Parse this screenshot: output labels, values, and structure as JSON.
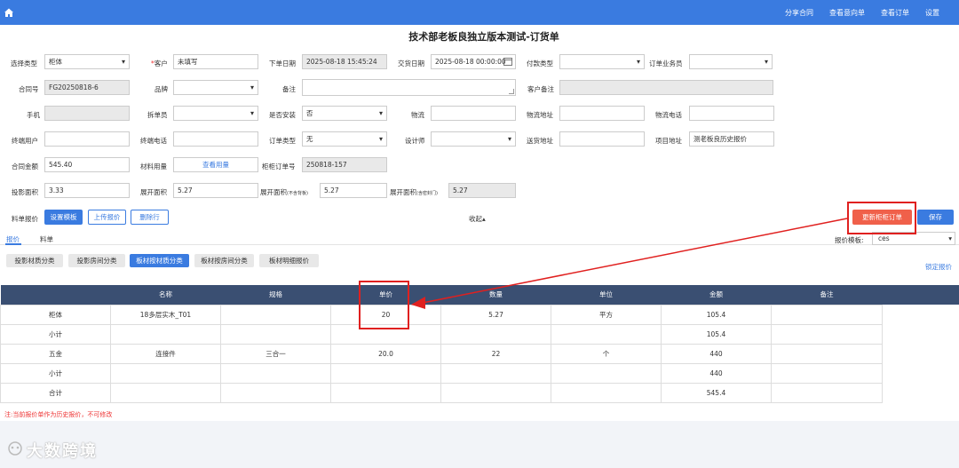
{
  "topbar": {
    "nav": [
      "分享合同",
      "查看意向单",
      "查看订单",
      "设置"
    ]
  },
  "title": "技术部老板良独立版本测试-订货单",
  "form": {
    "select_type": {
      "label": "选择类型",
      "value": "柜体"
    },
    "customer": {
      "label": "客户",
      "value": "未填写"
    },
    "order_date": {
      "label": "下单日期",
      "value": "2025-08-18 15:45:24"
    },
    "delivery_date": {
      "label": "交货日期",
      "value": "2025-08-18 00:00:00"
    },
    "payment_type": {
      "label": "付款类型",
      "value": ""
    },
    "salesperson": {
      "label": "订单业务员",
      "value": ""
    },
    "contract_no": {
      "label": "合同号",
      "value": "FG20250818-6"
    },
    "brand": {
      "label": "品牌",
      "value": ""
    },
    "remark": {
      "label": "备注",
      "value": ""
    },
    "customer_remark": {
      "label": "客户备注",
      "value": ""
    },
    "phone": {
      "label": "手机",
      "value": ""
    },
    "splitter": {
      "label": "拆单员",
      "value": ""
    },
    "install": {
      "label": "是否安装",
      "value": "否"
    },
    "logistics": {
      "label": "物流",
      "value": ""
    },
    "logistics_address": {
      "label": "物流地址",
      "value": ""
    },
    "logistics_phone": {
      "label": "物流电话",
      "value": ""
    },
    "end_user": {
      "label": "终端用户",
      "value": ""
    },
    "end_phone": {
      "label": "终端电话",
      "value": ""
    },
    "order_type": {
      "label": "订单类型",
      "value": "无"
    },
    "designer": {
      "label": "设计师",
      "value": ""
    },
    "ship_address": {
      "label": "送货地址",
      "value": ""
    },
    "project_address": {
      "label": "项目地址",
      "value": "测老板良历史报价"
    },
    "contract_amount": {
      "label": "合同金额",
      "value": "545.40"
    },
    "material_usage": {
      "label": "材料用量",
      "value": "查看用量"
    },
    "cabinet_order_no": {
      "label": "柜柜订单号",
      "value": "250818-157"
    },
    "projected_area": {
      "label": "投影面积",
      "value": "3.33"
    },
    "unfolded_area": {
      "label": "展开面积",
      "value": "5.27"
    },
    "unfolded_area_nodoor": {
      "label": "展开面积",
      "sub": "(不含背板)",
      "value": "5.27"
    },
    "unfolded_area_door": {
      "label": "展开面积",
      "sub": "(含密封门)",
      "value": "5.27"
    }
  },
  "quote_actions": {
    "label": "料单报价",
    "set_template": "设置模板",
    "upload": "上传报价",
    "delete_row": "删除行"
  },
  "collapse_label": "收起▴",
  "update_button": "更新柜柜订单",
  "save_button": "保存",
  "tabs": [
    "报价",
    "料单"
  ],
  "quote_template": {
    "label": "报价模板:",
    "value": "ces"
  },
  "categories": [
    "投影材质分类",
    "投影房间分类",
    "板材按材质分类",
    "板材按房间分类",
    "板材明细报价"
  ],
  "lock_quote": "锁定报价",
  "table": {
    "headers": [
      "",
      "名称",
      "规格",
      "单价",
      "数量",
      "单位",
      "金额",
      "备注"
    ],
    "rows": [
      [
        "柜体",
        "18多层实木_T01",
        "",
        "20",
        "5.27",
        "平方",
        "105.4",
        ""
      ],
      [
        "小计",
        "",
        "",
        "",
        "",
        "",
        "105.4",
        ""
      ],
      [
        "五金",
        "连接件",
        "三合一",
        "20.0",
        "22",
        "个",
        "440",
        ""
      ],
      [
        "小计",
        "",
        "",
        "",
        "",
        "",
        "440",
        ""
      ],
      [
        "合计",
        "",
        "",
        "",
        "",
        "",
        "545.4",
        ""
      ]
    ]
  },
  "note": "注:当前报价单作为历史报价，不可修改",
  "watermark": "大数跨境",
  "colors": {
    "primary": "#3a7be0",
    "header_dark": "#3a4f72",
    "danger": "#f0604a",
    "highlight": "#e0201f"
  }
}
